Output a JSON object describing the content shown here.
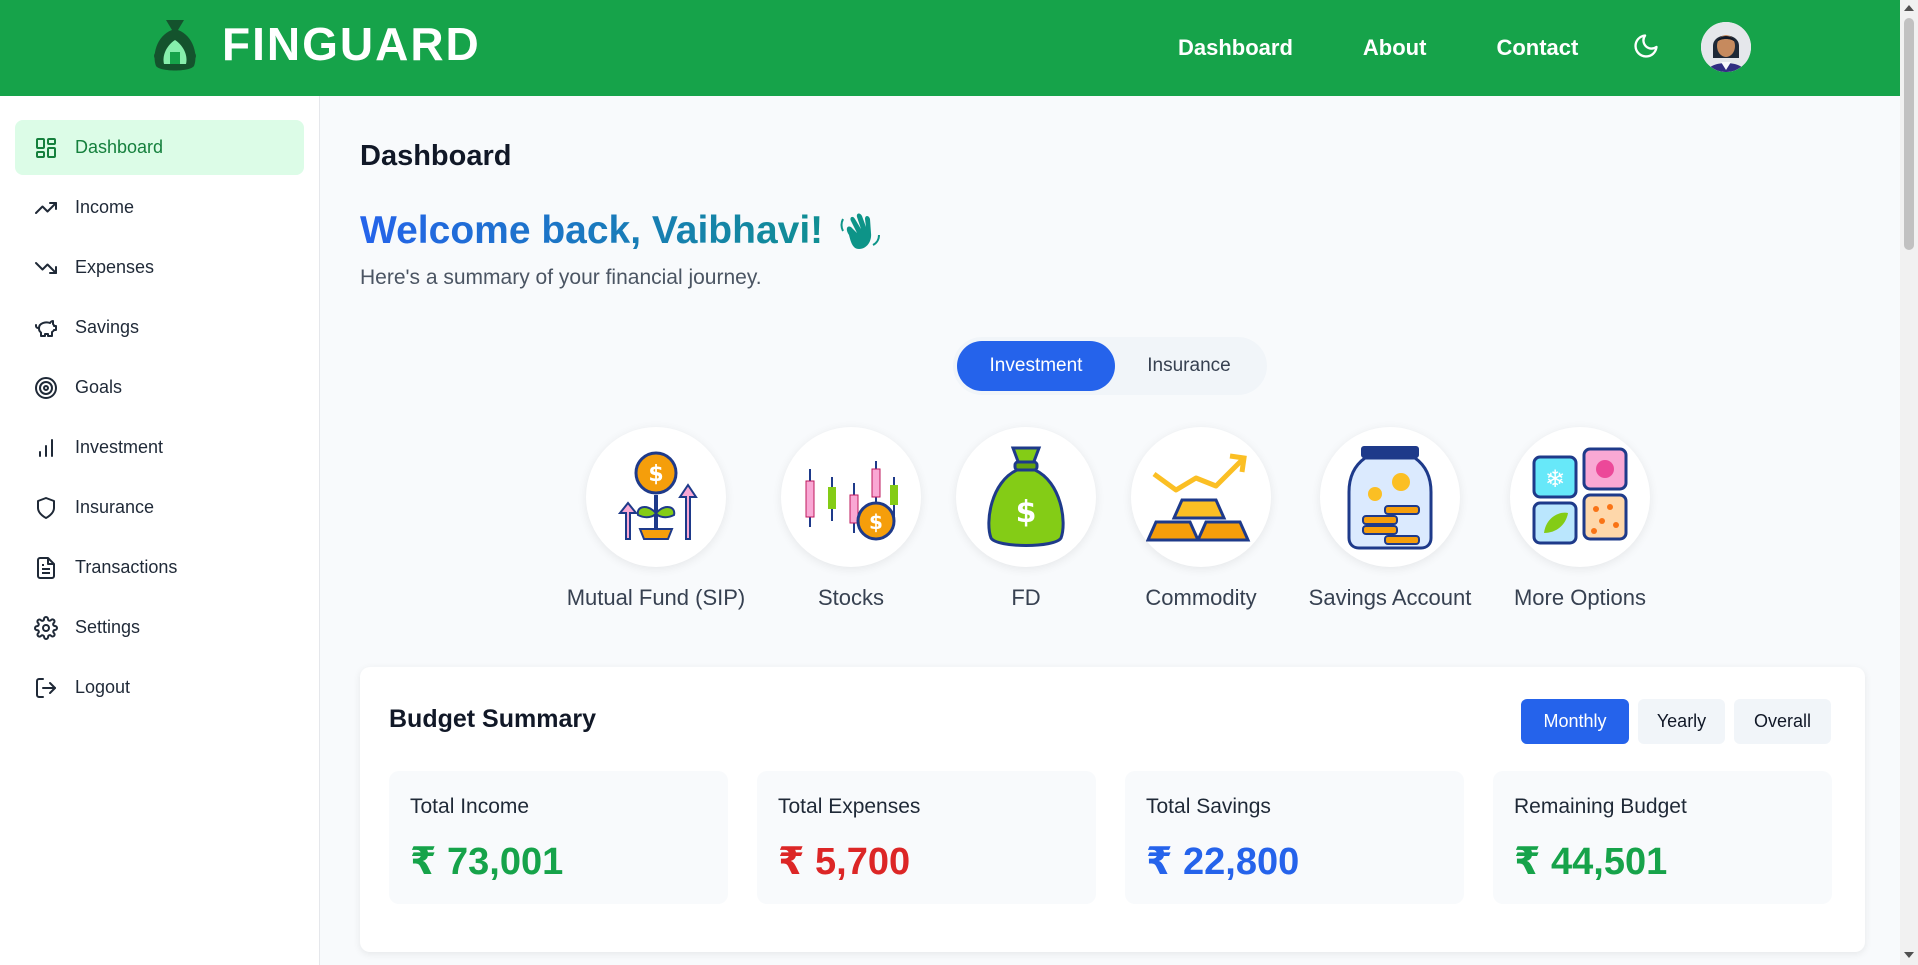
{
  "brand": {
    "name": "FINGUARD"
  },
  "topnav": {
    "items": [
      "Dashboard",
      "About",
      "Contact"
    ]
  },
  "sidebar": {
    "items": [
      {
        "label": "Dashboard",
        "icon": "grid-icon",
        "active": true
      },
      {
        "label": "Income",
        "icon": "trending-up-icon"
      },
      {
        "label": "Expenses",
        "icon": "trending-down-icon"
      },
      {
        "label": "Savings",
        "icon": "piggy-bank-icon"
      },
      {
        "label": "Goals",
        "icon": "target-icon"
      },
      {
        "label": "Investment",
        "icon": "bar-chart-icon"
      },
      {
        "label": "Insurance",
        "icon": "shield-icon"
      },
      {
        "label": "Transactions",
        "icon": "file-text-icon"
      },
      {
        "label": "Settings",
        "icon": "gear-icon"
      },
      {
        "label": "Logout",
        "icon": "logout-icon"
      }
    ]
  },
  "main": {
    "title": "Dashboard",
    "welcome": "Welcome back, Vaibhavi!",
    "subtitle": "Here's a summary of your financial journey.",
    "tabs": {
      "active": "Investment",
      "inactive": "Insurance"
    },
    "options": [
      "Mutual Fund (SIP)",
      "Stocks",
      "FD",
      "Commodity",
      "Savings Account",
      "More Options"
    ]
  },
  "budget": {
    "title": "Budget Summary",
    "periods": [
      "Monthly",
      "Yearly",
      "Overall"
    ],
    "active_period": "Monthly",
    "cards": [
      {
        "label": "Total Income",
        "value": "₹ 73,001",
        "color": "#16a34a"
      },
      {
        "label": "Total Expenses",
        "value": "₹ 5,700",
        "color": "#dc2626"
      },
      {
        "label": "Total Savings",
        "value": "₹ 22,800",
        "color": "#2563eb"
      },
      {
        "label": "Remaining Budget",
        "value": "₹ 44,501",
        "color": "#16a34a"
      }
    ]
  },
  "colors": {
    "brand_green": "#16a34a",
    "accent_blue": "#2563eb",
    "active_bg": "#dcfce7"
  }
}
